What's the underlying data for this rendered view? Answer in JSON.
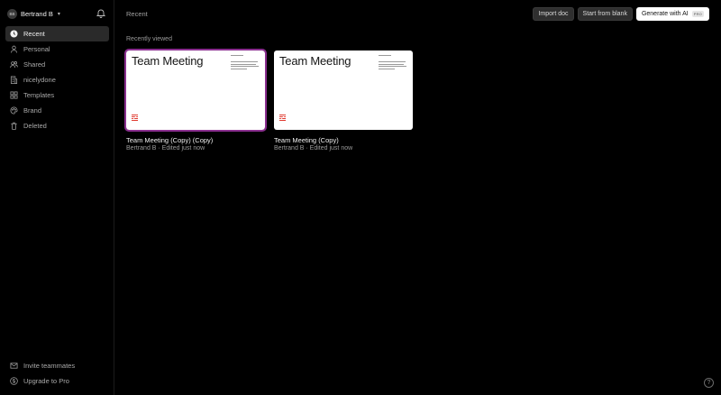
{
  "user": {
    "initials": "BB",
    "name": "Bertrand B"
  },
  "nav": [
    {
      "label": "Recent",
      "icon": "clock-icon",
      "active": true
    },
    {
      "label": "Personal",
      "icon": "user-icon"
    },
    {
      "label": "Shared",
      "icon": "users-icon"
    },
    {
      "label": "nicelydone",
      "icon": "building-icon"
    },
    {
      "label": "Templates",
      "icon": "grid-icon"
    },
    {
      "label": "Brand",
      "icon": "palette-icon"
    },
    {
      "label": "Deleted",
      "icon": "trash-icon"
    }
  ],
  "bottom_nav": [
    {
      "label": "Invite teammates",
      "icon": "mail-icon"
    },
    {
      "label": "Upgrade to Pro",
      "icon": "dollar-icon"
    }
  ],
  "header": {
    "breadcrumb": "Recent",
    "import_label": "Import doc",
    "blank_label": "Start from blank",
    "ai_label": "Generate with AI",
    "pro_badge": "PRO"
  },
  "section_title": "Recently viewed",
  "cards": [
    {
      "thumb_title": "Team Meeting",
      "title": "Team Meeting (Copy) (Copy)",
      "meta": "Bertrand B · Edited just now"
    },
    {
      "thumb_title": "Team Meeting",
      "title": "Team Meeting (Copy)",
      "meta": "Bertrand B · Edited just now"
    }
  ],
  "help": "?",
  "colors": {
    "accent_selected": "#8a2f8f",
    "logo_red": "#e03a2f"
  }
}
